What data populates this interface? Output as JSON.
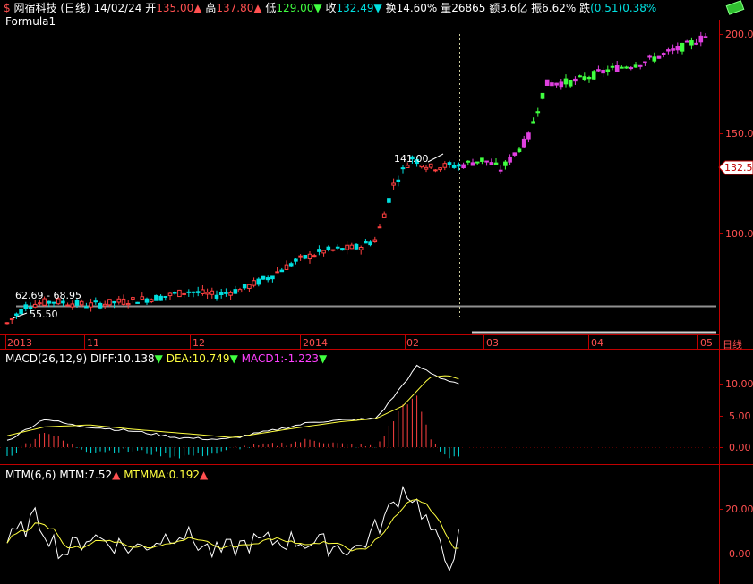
{
  "header": {
    "stock_name": "网宿科技",
    "period": "(日线)",
    "date": "14/02/24",
    "open_label": "开",
    "open": "135.00",
    "high_label": "高",
    "high": "137.80",
    "low_label": "低",
    "low": "129.00",
    "close_label": "收",
    "close": "132.49",
    "turnover_label": "换",
    "turnover": "14.60%",
    "volume_label": "量",
    "volume": "26865",
    "amount_label": "额",
    "amount": "3.6亿",
    "amplitude_label": "振",
    "amplitude": "6.62%",
    "change_label": "跌",
    "change": "(0.51)0.38%"
  },
  "formula_label": "Formula1",
  "price_panel": {
    "y_ticks": [
      "200.0",
      "150.0",
      "100.0"
    ],
    "current_price_tag": "132.5",
    "annotation_high": "141.00",
    "annotation_low_pair": "62.69 - 68.95",
    "annotation_low": "55.50"
  },
  "time_axis": {
    "labels": [
      "2013",
      "11",
      "12",
      "2014",
      "02",
      "03",
      "04",
      "05"
    ],
    "unit": "日线"
  },
  "macd_panel": {
    "title": "MACD(26,12,9)",
    "diff_label": "DIFF:10.138",
    "dea_label": "DEA:10.749",
    "macd_label": "MACD1:-1.223",
    "y_ticks": [
      "10.00",
      "5.00",
      "0.00"
    ]
  },
  "mtm_panel": {
    "title": "MTM(6,6)",
    "mtm_label": "MTM:7.52",
    "mtmma_label": "MTMMA:0.192",
    "y_ticks": [
      "20.00",
      "0.00"
    ]
  },
  "colors": {
    "up": "#ff4040",
    "down": "#00e0e0",
    "forecast_up": "#e040e0",
    "forecast_down": "#40ff40",
    "axis_red": "#c00000",
    "dea": "#ffff40"
  }
}
